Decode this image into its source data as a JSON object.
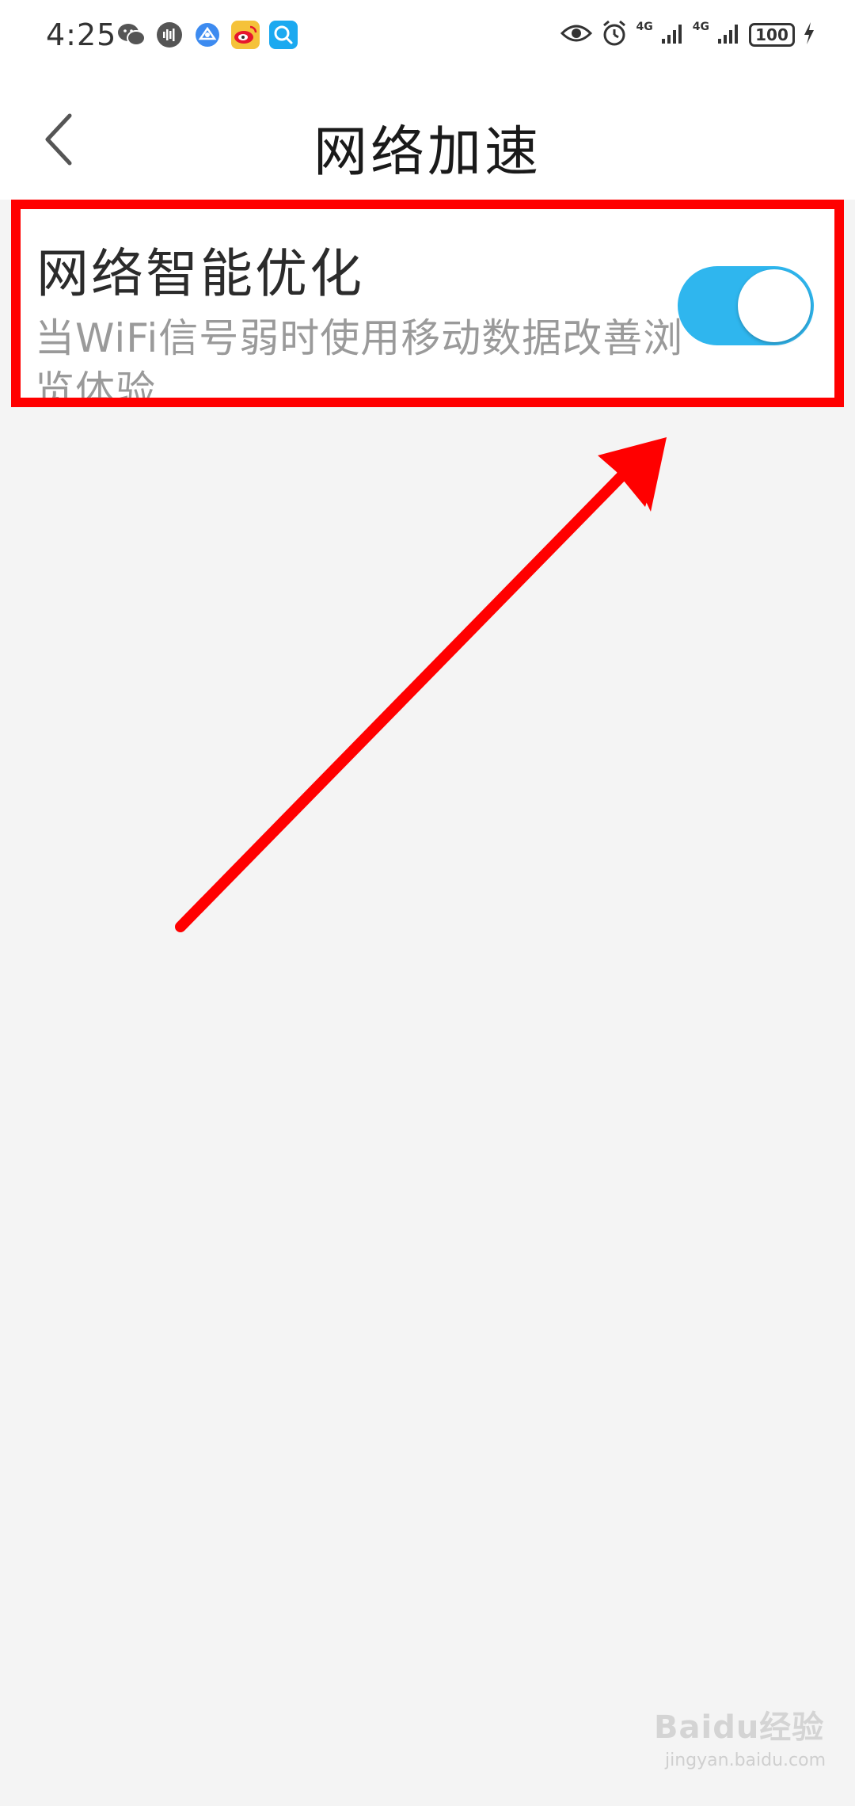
{
  "status_bar": {
    "time": "4:25",
    "network_1": "4G",
    "network_2": "4G",
    "battery": "100",
    "apps": [
      "wechat-icon",
      "voice-icon",
      "browser-icon",
      "weibo-icon",
      "search-app-icon"
    ]
  },
  "header": {
    "title": "网络加速",
    "back_icon": "chevron-left-icon"
  },
  "setting": {
    "title": "网络智能优化",
    "description": "当WiFi信号弱时使用移动数据改善浏览体验",
    "toggle_on": true,
    "toggle_color": "#2fb6ee"
  },
  "annotation": {
    "box_color": "#ff0000",
    "arrow_color": "#ff0000"
  },
  "watermark": {
    "main": "Baidu经验",
    "sub": "jingyan.baidu.com"
  }
}
